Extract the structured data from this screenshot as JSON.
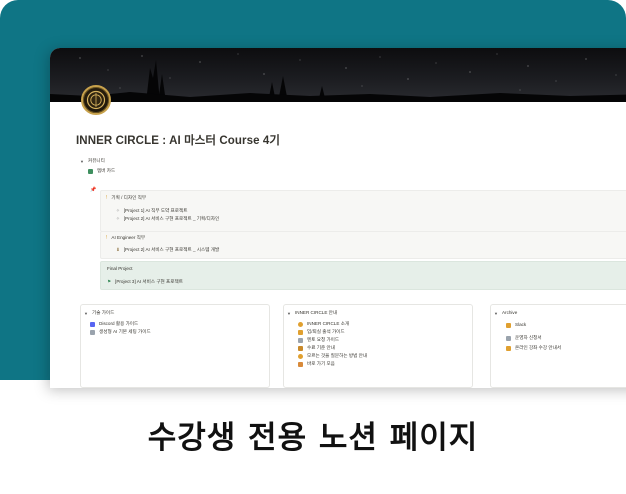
{
  "page": {
    "title": "INNER CIRCLE : AI 마스터 Course 4기",
    "colors": {
      "frame": "#0f7585",
      "callout": "#f7f7f5",
      "callout_green": "#e6efe9",
      "text": "#37352f"
    }
  },
  "community": {
    "toggle_label": "커뮤니티",
    "member_card": "멤버 카드"
  },
  "plan": {
    "pin_icon": "pin-icon",
    "planning_header": "기획 / 디자인 직무",
    "planning_items": [
      "[Project 1] AI 직무 도약 프로젝트",
      "[Project 2] AI 서비스 구현 프로젝트 _ 기획/디자인"
    ],
    "engineer_header": "AI Engineer 직무",
    "engineer_items": [
      "[Project 2] AI 서비스 구현 프로젝트 _ 시스템 개발"
    ],
    "final_header": "Final Project",
    "final_items": [
      "[Project 3] AI 서비스 구현 프로젝트"
    ]
  },
  "columns": {
    "guide": {
      "title": "기술 가이드",
      "items": [
        "Discord 활용 가이드",
        "생성형 AI 기본 세팅 가이드"
      ]
    },
    "inner": {
      "title": "INNER CIRCLE 안내",
      "items": [
        "INNER CIRCLE 소개",
        "입/퇴실 출석 가이드",
        "멘토 요청 가이드",
        "수료 기준 안내",
        "모르는 것을 질문하는 방법 안내",
        "바로 가기 모음"
      ]
    },
    "archive": {
      "title": "Archive",
      "items": [
        "Slack",
        "운영자 신청서",
        "온라인 강좌 수강 안내서"
      ]
    }
  },
  "footer": {
    "headline": "수강생 전용 노션 페이지"
  }
}
